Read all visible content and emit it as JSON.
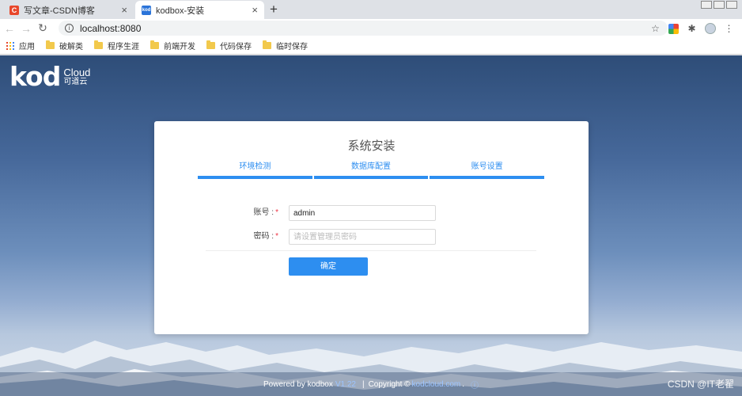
{
  "browser": {
    "tabs": [
      {
        "favicon": "C",
        "title": "写文章-CSDN博客",
        "close": "×"
      },
      {
        "favicon": "kod",
        "title": "kodbox-安装",
        "close": "×"
      }
    ],
    "new_tab": "+",
    "back_icon": "←",
    "forward_icon": "→",
    "reload_icon": "↻",
    "url": "localhost:8080",
    "info_icon": "i",
    "star_icon": "☆",
    "puzzle_icon": "✱",
    "menu_icon": "⋮",
    "bookmarks": [
      {
        "label": "应用"
      },
      {
        "label": "破解类"
      },
      {
        "label": "程序生涯"
      },
      {
        "label": "前端开发"
      },
      {
        "label": "代码保存"
      },
      {
        "label": "临时保存"
      }
    ]
  },
  "page": {
    "logo_main": "kod",
    "logo_cloud": "Cloud",
    "logo_cn": "可道云",
    "title": "系统安装",
    "steps": [
      "环境检测",
      "数据库配置",
      "账号设置"
    ],
    "form": {
      "account_label": "账号 :",
      "account_value": "admin",
      "password_label": "密码 :",
      "password_placeholder": "请设置管理员密码",
      "required_mark": "*",
      "submit": "确定"
    },
    "footer": {
      "powered": "Powered by kodbox",
      "version": "V1.22",
      "separator": "|",
      "copyright": "Copyright ©",
      "link": "kodcloud.com",
      "period": ".",
      "help_icon": "ⓘ"
    },
    "watermark": "CSDN @IT老翟"
  },
  "colors": {
    "accent": "#2d8ef0",
    "required": "#ee3344"
  }
}
